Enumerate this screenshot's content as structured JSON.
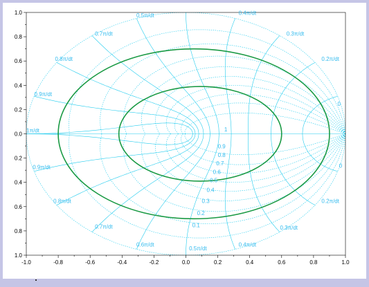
{
  "colors": {
    "window_bg": "#c5c5e6",
    "plot_bg": "#ffffff",
    "grid": "#22ccee",
    "grid_label": "#33bbee",
    "curve": "#1a9a44",
    "axis": "#000000"
  },
  "chart_data": {
    "type": "line",
    "title": "",
    "xlabel": "",
    "ylabel": "",
    "xlim": [
      -1.0,
      1.0
    ],
    "ylim": [
      -1.0,
      1.0
    ],
    "grid": "zgrid",
    "x_ticks": [
      "-1.0",
      "-0.8",
      "-0.6",
      "-0.4",
      "-0.2",
      "0.0",
      "0.2",
      "0.4",
      "0.6",
      "0.8",
      "1.0"
    ],
    "y_ticks": [
      "1.0",
      "0.8",
      "0.6",
      "0.4",
      "0.2",
      "0.0",
      "0.2",
      "0.4",
      "0.6",
      "0.8",
      "1.0"
    ],
    "damping_labels": [
      {
        "text": "0.9",
        "x": 0.2,
        "y": -0.12
      },
      {
        "text": "0.8",
        "x": 0.2,
        "y": -0.19
      },
      {
        "text": "0.7",
        "x": 0.19,
        "y": -0.26
      },
      {
        "text": "0.6",
        "x": 0.17,
        "y": -0.33
      },
      {
        "text": "0.5",
        "x": 0.15,
        "y": -0.4
      },
      {
        "text": "0.4",
        "x": 0.13,
        "y": -0.48
      },
      {
        "text": "0.3",
        "x": 0.1,
        "y": -0.57
      },
      {
        "text": "0.2",
        "x": 0.07,
        "y": -0.67
      },
      {
        "text": "0.1",
        "x": 0.04,
        "y": -0.77
      },
      {
        "text": "1",
        "x": 0.24,
        "y": 0.02
      },
      {
        "text": "0",
        "x": 0.95,
        "y": 0.23
      },
      {
        "text": "0",
        "x": 0.96,
        "y": -0.28
      }
    ],
    "frequency_labels": [
      {
        "text": "0.5π/dt",
        "x": -0.31,
        "y": 0.96
      },
      {
        "text": "0.4π/dt",
        "x": 0.33,
        "y": 0.98
      },
      {
        "text": "0.3π/dt",
        "x": 0.63,
        "y": 0.81
      },
      {
        "text": "0.2π/dt",
        "x": 0.85,
        "y": 0.6
      },
      {
        "text": "0.7π/dt",
        "x": -0.57,
        "y": 0.81
      },
      {
        "text": "0.8π/dt",
        "x": -0.82,
        "y": 0.6
      },
      {
        "text": "0.9π/dt",
        "x": -0.95,
        "y": 0.31
      },
      {
        "text": "1π/dt",
        "x": -1.0,
        "y": 0.01
      },
      {
        "text": "0.9π/dt",
        "x": -0.96,
        "y": -0.29
      },
      {
        "text": "0.8π/dt",
        "x": -0.83,
        "y": -0.57
      },
      {
        "text": "0.7π/dt",
        "x": -0.57,
        "y": -0.78
      },
      {
        "text": "0.6π/dt",
        "x": -0.31,
        "y": -0.93
      },
      {
        "text": "0.5π/dt",
        "x": 0.02,
        "y": -0.96
      },
      {
        "text": "0.4π/dt",
        "x": 0.33,
        "y": -0.93
      },
      {
        "text": "0.3π/dt",
        "x": 0.59,
        "y": -0.79
      },
      {
        "text": "0.2π/dt",
        "x": 0.85,
        "y": -0.57
      }
    ],
    "series": [
      {
        "shape": "ellipse",
        "center": [
          0.05,
          0.0
        ],
        "radius_x": 0.85,
        "radius_y": 0.7
      },
      {
        "shape": "ellipse",
        "center": [
          0.09,
          0.0
        ],
        "radius_x": 0.51,
        "radius_y": 0.39
      }
    ]
  }
}
